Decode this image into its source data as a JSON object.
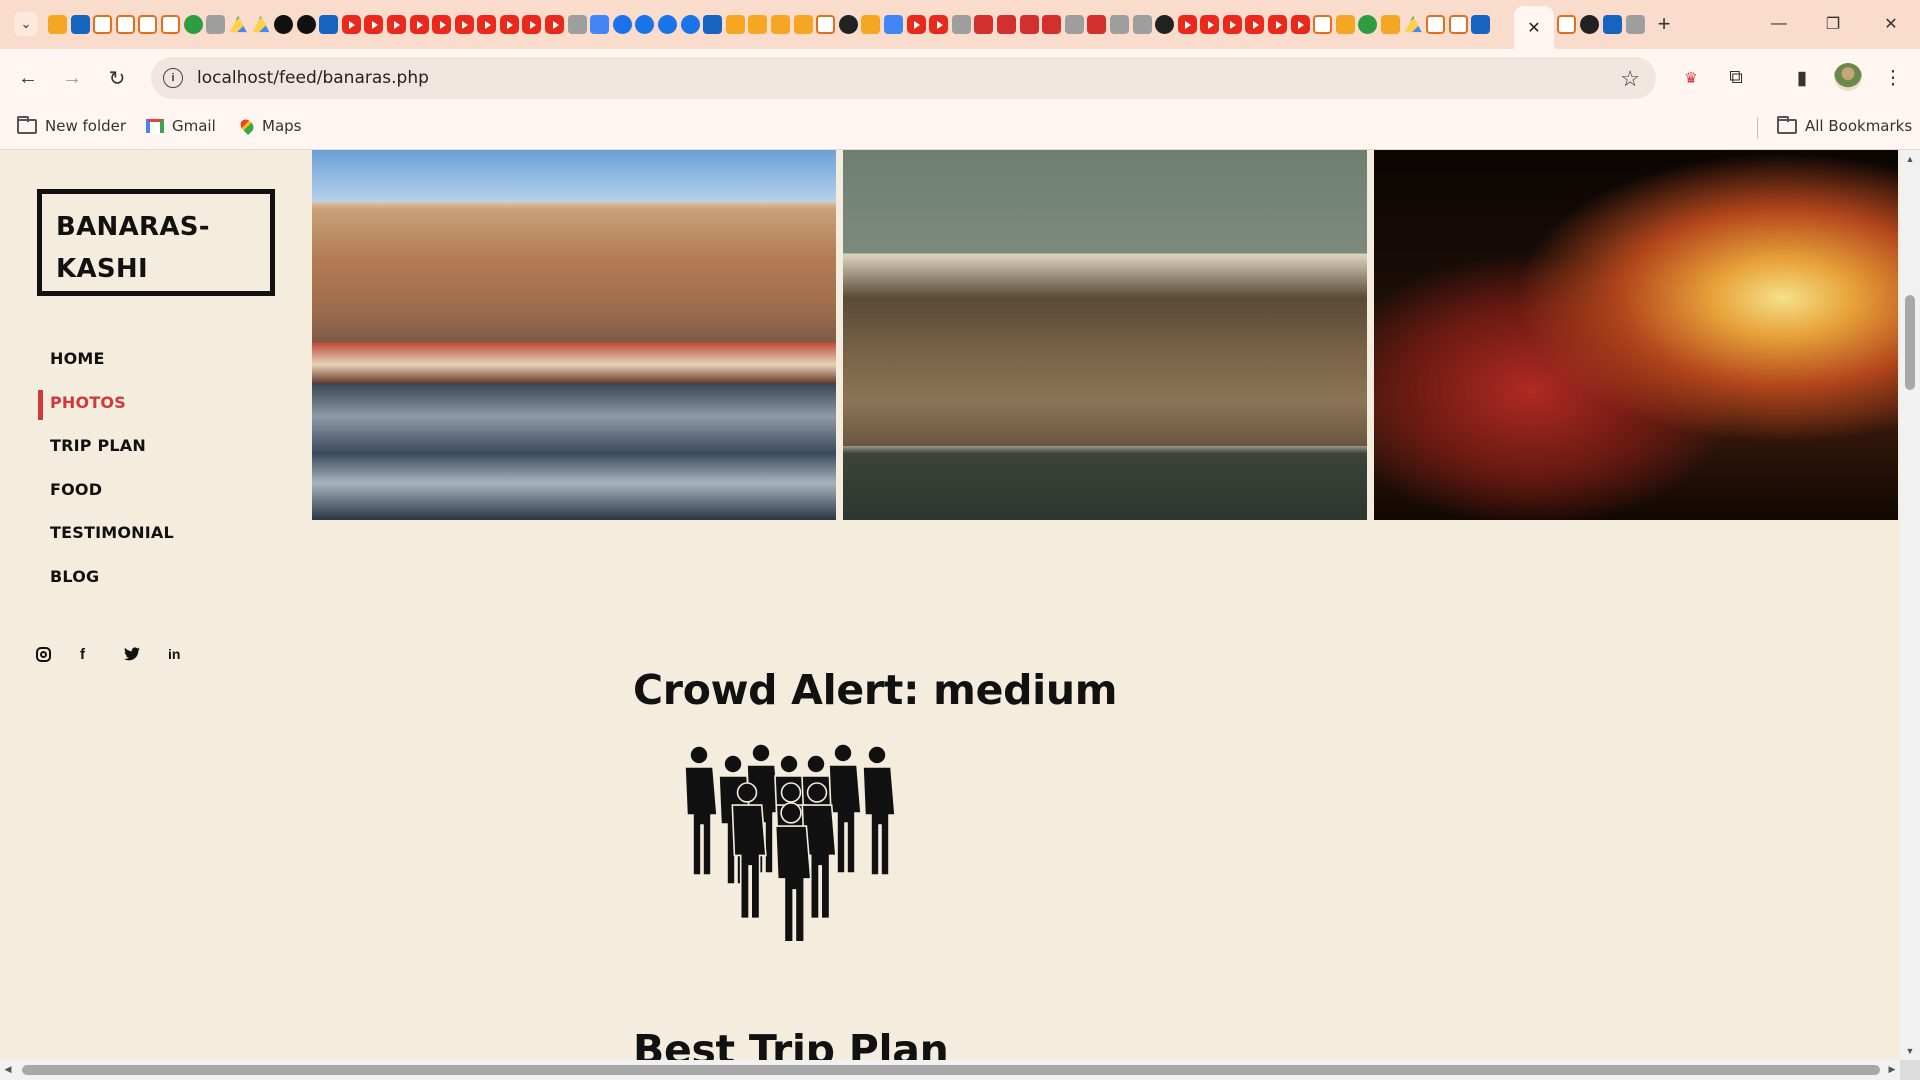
{
  "browser": {
    "url": "localhost/feed/banaras.php",
    "bookmarks": [
      {
        "label": "New folder",
        "icon": "folder-icon"
      },
      {
        "label": "Gmail",
        "icon": "gmail-icon"
      },
      {
        "label": "Maps",
        "icon": "maps-icon"
      }
    ],
    "all_bookmarks_label": "All Bookmarks",
    "favicons": [
      "fox",
      "grid",
      "h",
      "h",
      "h",
      "h",
      "tv",
      "person",
      "drive",
      "drive",
      "dark",
      "dark",
      "prime",
      "yt",
      "yt",
      "yt",
      "yt",
      "yt",
      "yt",
      "yt",
      "yt",
      "yt",
      "yt",
      "grey",
      "doc",
      "c",
      "c",
      "c",
      "c",
      "s",
      "orange",
      "orange",
      "orange",
      "orange",
      "g",
      "gh",
      "orange",
      "doc",
      "yt",
      "yt",
      "grey",
      "red",
      "red",
      "red",
      "red",
      "grey",
      "red",
      "grey",
      "grey",
      "gh",
      "yt",
      "yt",
      "yt",
      "yt",
      "yt",
      "yt",
      "outline",
      "orange",
      "green",
      "orange",
      "drive",
      "outline",
      "outline",
      "s"
    ],
    "favicons_after_active": [
      "outline",
      "gh",
      "s",
      "grey"
    ]
  },
  "site": {
    "logo": "BANARAS-KASHI",
    "nav": [
      {
        "label": "HOME",
        "active": false
      },
      {
        "label": "PHOTOS",
        "active": true
      },
      {
        "label": "TRIP PLAN",
        "active": false
      },
      {
        "label": "FOOD",
        "active": false
      },
      {
        "label": "TESTIMONIAL",
        "active": false
      },
      {
        "label": "BLOG",
        "active": false
      }
    ],
    "social": [
      "instagram-icon",
      "facebook-icon",
      "twitter-icon",
      "linkedin-icon"
    ],
    "crowd_alert": "Crowd Alert: medium",
    "next_section_title": "Best Trip Plan",
    "accent_color": "#d0393b",
    "background_color": "#f4ecdc"
  }
}
